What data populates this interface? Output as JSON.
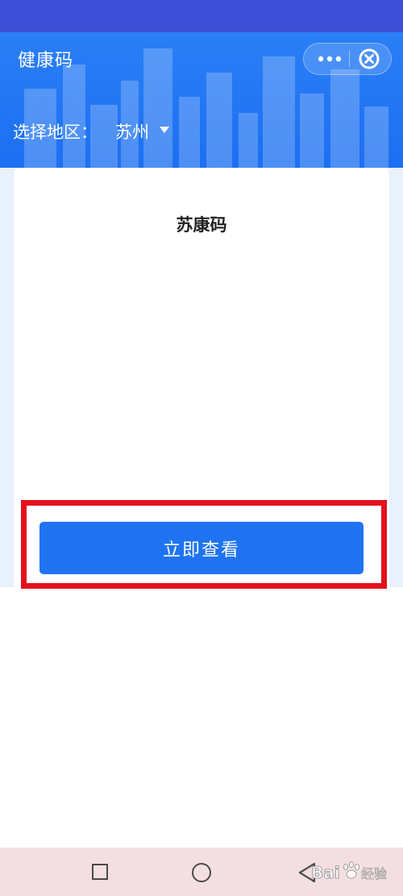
{
  "header": {
    "title": "健康码",
    "more_icon": "more-dots-icon",
    "close_icon": "close-circle-icon",
    "background_color": "#1c6ff2"
  },
  "region": {
    "label": "选择地区：",
    "value": "苏州",
    "caret_icon": "caret-down-icon"
  },
  "card": {
    "title": "苏康码",
    "button_label": "立即查看",
    "button_color": "#1f73f1",
    "highlight_color": "#e3121d"
  },
  "nav_bar": {
    "recent_icon": "square-icon",
    "home_icon": "circle-icon",
    "back_icon": "back-triangle-icon",
    "background_color": "#f3dfe2"
  },
  "watermark": {
    "text": "Bai经验",
    "icon": "baidu-paw-icon"
  }
}
